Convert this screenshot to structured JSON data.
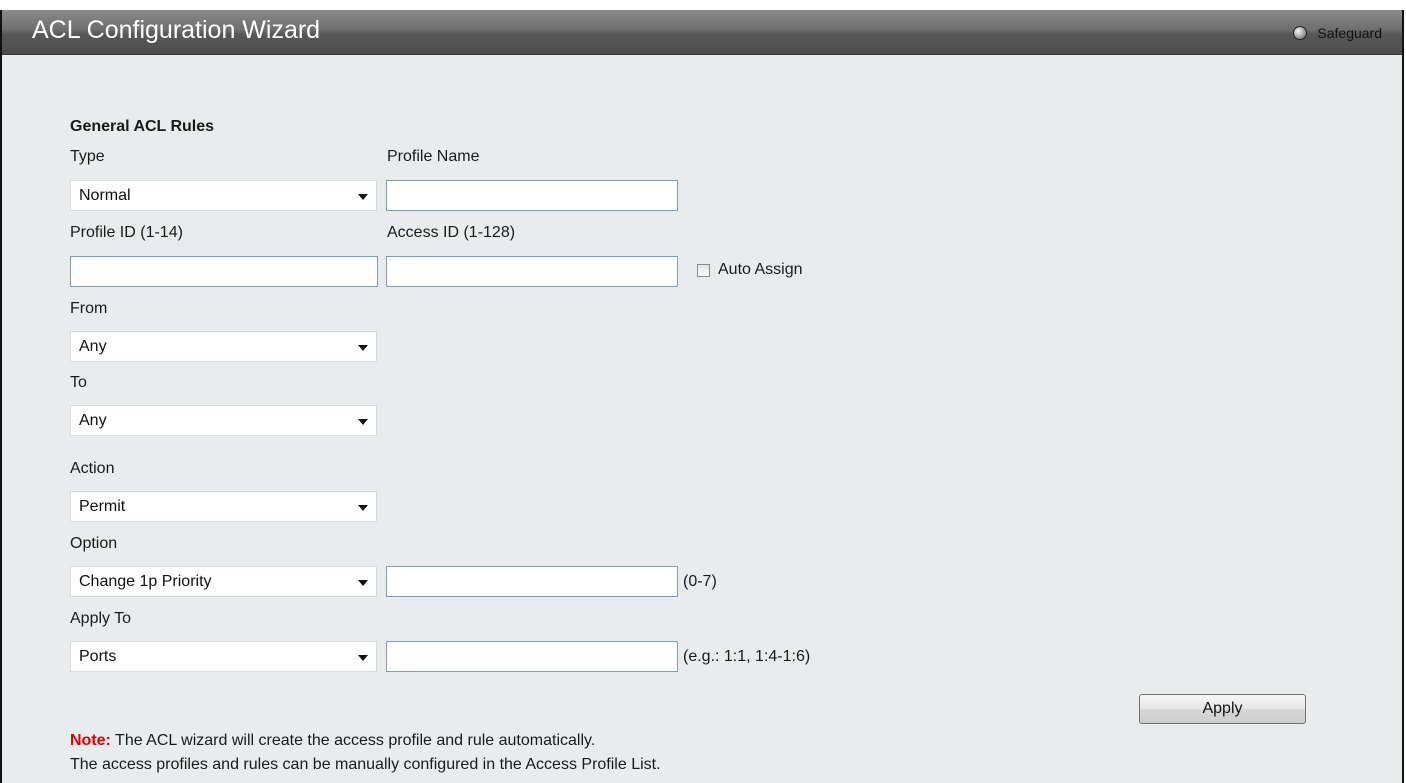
{
  "window": {
    "title": "ACL Configuration Wizard",
    "safeguard_label": "Safeguard"
  },
  "form": {
    "section_title": "General ACL Rules",
    "type_label": "Type",
    "type_value": "Normal",
    "profile_name_label": "Profile Name",
    "profile_name_value": "",
    "profile_id_label": "Profile ID (1-14)",
    "profile_id_value": "",
    "access_id_label": "Access ID (1-128)",
    "access_id_value": "",
    "auto_assign_label": "Auto Assign",
    "auto_assign_checked": false,
    "from_label": "From",
    "from_value": "Any",
    "to_label": "To",
    "to_value": "Any",
    "action_label": "Action",
    "action_value": "Permit",
    "option_label": "Option",
    "option_value": "Change 1p Priority",
    "option_input_value": "",
    "option_hint": "(0-7)",
    "apply_to_label": "Apply To",
    "apply_to_value": "Ports",
    "apply_to_input_value": "",
    "apply_to_hint": "(e.g.: 1:1, 1:4-1:6)",
    "apply_button": "Apply"
  },
  "note": {
    "prefix": "Note:",
    "line1": " The ACL wizard will create the access profile and rule automatically.",
    "line2": "The access profiles and rules can be manually configured in the Access Profile List."
  }
}
